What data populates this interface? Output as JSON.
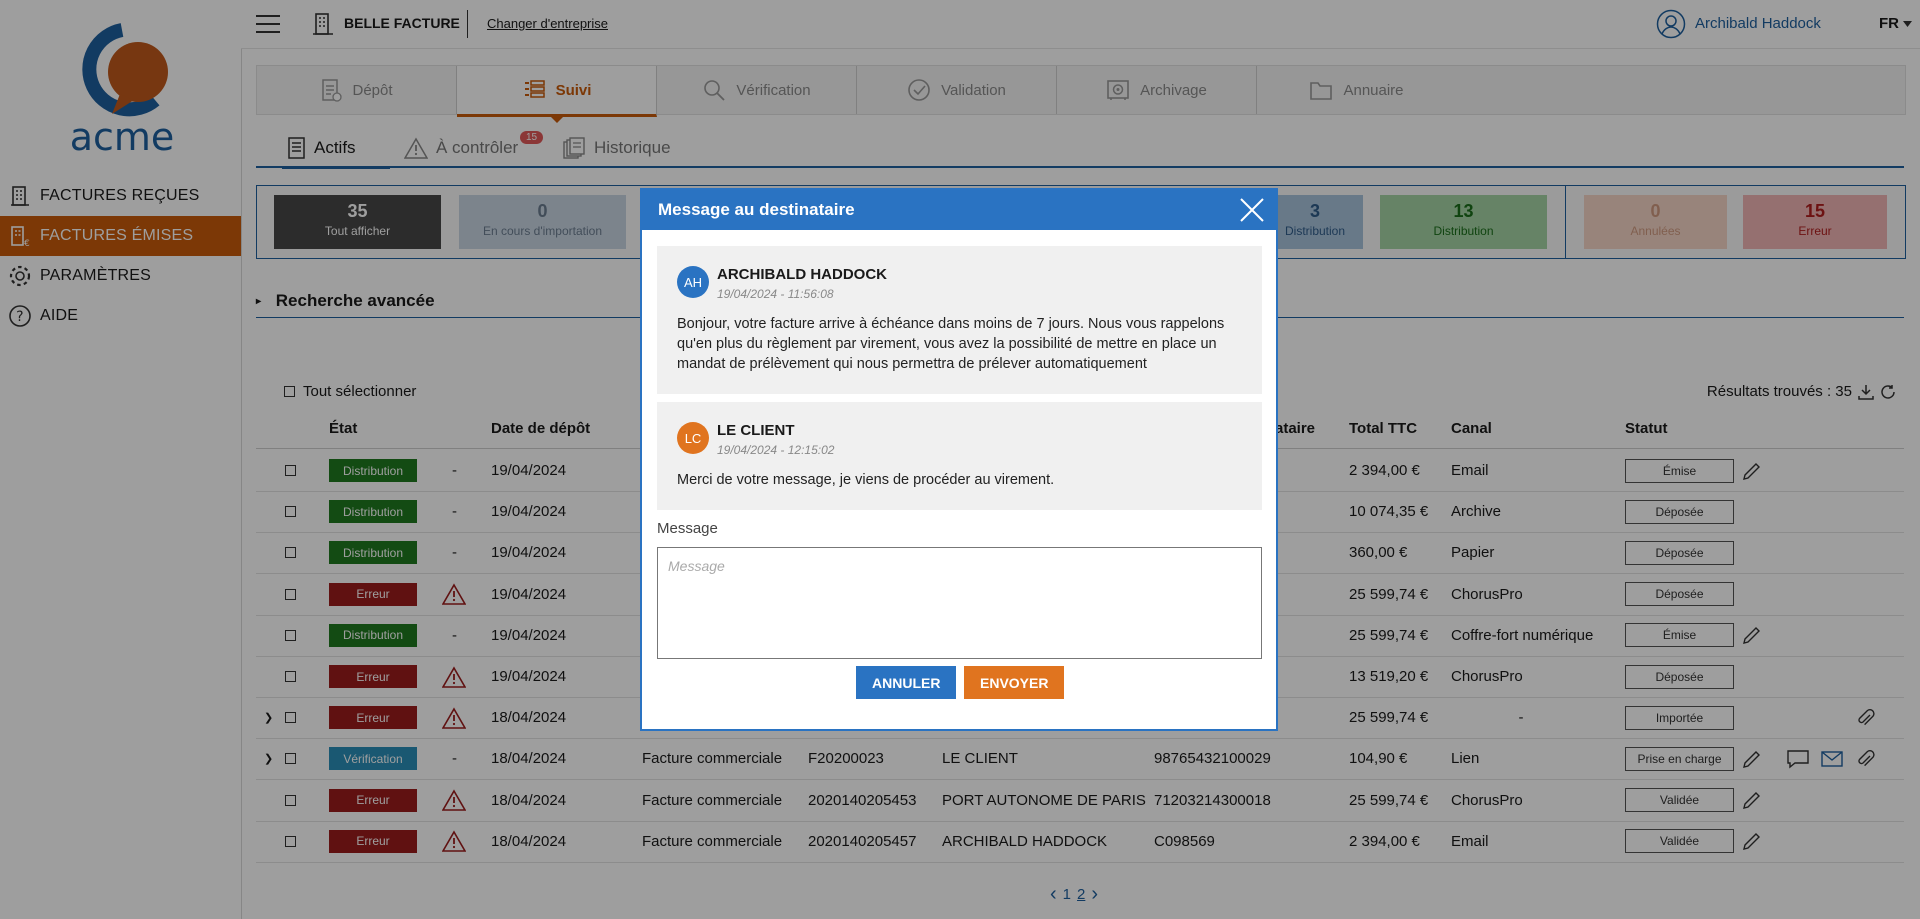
{
  "brand": {
    "logo_text": "acme",
    "company": "BELLE FACTURE",
    "change_company": "Changer d'entreprise"
  },
  "user": {
    "name": "Archibald Haddock",
    "lang": "FR"
  },
  "sidebar": {
    "items": [
      {
        "label": "FACTURES REÇUES",
        "icon": "building-icon"
      },
      {
        "label": "FACTURES ÉMISES",
        "icon": "building-euro-icon",
        "active": true
      },
      {
        "label": "PARAMÈTRES",
        "icon": "gear-icon"
      },
      {
        "label": "AIDE",
        "icon": "help-icon"
      }
    ]
  },
  "main_tabs": [
    {
      "label": "Dépôt",
      "icon": "document-icon"
    },
    {
      "label": "Suivi",
      "icon": "list-icon",
      "active": true
    },
    {
      "label": "Vérification",
      "icon": "search-icon"
    },
    {
      "label": "Validation",
      "icon": "check-circle-icon"
    },
    {
      "label": "Archivage",
      "icon": "safe-icon"
    },
    {
      "label": "Annuaire",
      "icon": "folder-icon"
    }
  ],
  "sub_tabs": [
    {
      "label": "Actifs",
      "active": true
    },
    {
      "label": "À contrôler",
      "badge": "15"
    },
    {
      "label": "Historique"
    }
  ],
  "counters": [
    {
      "value": "35",
      "label": "Tout afficher",
      "bg": "#474747",
      "fg": "#ffffff"
    },
    {
      "value": "0",
      "label": "En cours d'importation",
      "bg": "#c9d6e3",
      "fg": "#6b7d90"
    },
    {
      "value": "3",
      "label": "Distribution",
      "bg": "#a9c3dc",
      "fg": "#2f5c8a"
    },
    {
      "value": "13",
      "label": "Distribution",
      "bg": "#a5d4a5",
      "fg": "#1b6e1b"
    },
    {
      "value": "0",
      "label": "Annulées",
      "bg": "#f5d6c7",
      "fg": "#d09a80"
    },
    {
      "value": "15",
      "label": "Erreur",
      "bg": "#f0b5b5",
      "fg": "#b01e1e"
    }
  ],
  "advanced_search": "Recherche avancée",
  "select_all": "Tout sélectionner",
  "results": "Résultats trouvés : 35",
  "headers": {
    "etat": "État",
    "date": "Date de dépôt",
    "destinataire": "ataire",
    "ttc": "Total TTC",
    "canal": "Canal",
    "statut": "Statut"
  },
  "colors": {
    "distribution": "#1f7a1f",
    "erreur": "#9b1c1c",
    "verification": "#2a8fb8",
    "accent": "#c85b0a",
    "blue": "#1e5f9e"
  },
  "rows": [
    {
      "expand": "",
      "etat": "Distribution",
      "etat_kind": "distribution",
      "warn": false,
      "date": "19/04/2024",
      "type": "",
      "num": "",
      "client": "",
      "siret": "",
      "ttc": "2 394,00 €",
      "canal": "Email",
      "statut": "Émise",
      "actions": [
        "edit"
      ]
    },
    {
      "expand": "",
      "etat": "Distribution",
      "etat_kind": "distribution",
      "warn": false,
      "date": "19/04/2024",
      "type": "",
      "num": "",
      "client": "",
      "siret": "",
      "ttc": "10 074,35 €",
      "canal": "Archive",
      "statut": "Déposée",
      "actions": []
    },
    {
      "expand": "",
      "etat": "Distribution",
      "etat_kind": "distribution",
      "warn": false,
      "date": "19/04/2024",
      "type": "",
      "num": "",
      "client": "",
      "siret": "",
      "ttc": "360,00 €",
      "canal": "Papier",
      "statut": "Déposée",
      "actions": []
    },
    {
      "expand": "",
      "etat": "Erreur",
      "etat_kind": "erreur",
      "warn": true,
      "date": "19/04/2024",
      "type": "",
      "num": "",
      "client": "",
      "siret": "",
      "ttc": "25 599,74 €",
      "canal": "ChorusPro",
      "statut": "Déposée",
      "actions": []
    },
    {
      "expand": "",
      "etat": "Distribution",
      "etat_kind": "distribution",
      "warn": false,
      "date": "19/04/2024",
      "type": "",
      "num": "",
      "client": "",
      "siret": "",
      "ttc": "25 599,74 €",
      "canal": "Coffre-fort numérique",
      "statut": "Émise",
      "actions": [
        "edit"
      ]
    },
    {
      "expand": "",
      "etat": "Erreur",
      "etat_kind": "erreur",
      "warn": true,
      "date": "19/04/2024",
      "type": "",
      "num": "",
      "client": "",
      "siret": "",
      "ttc": "13 519,20 €",
      "canal": "ChorusPro",
      "statut": "Déposée",
      "actions": []
    },
    {
      "expand": "❯",
      "etat": "Erreur",
      "etat_kind": "erreur",
      "warn": true,
      "date": "18/04/2024",
      "type": "",
      "num": "",
      "client": "",
      "siret": "",
      "ttc": "25 599,74 €",
      "canal": "-",
      "statut": "Importée",
      "actions": [
        "attach"
      ]
    },
    {
      "expand": "❯",
      "etat": "Vérification",
      "etat_kind": "verification",
      "warn": false,
      "date": "18/04/2024",
      "type": "Facture commerciale",
      "num": "F20200023",
      "client": "LE CLIENT",
      "siret": "98765432100029",
      "ttc": "104,90 €",
      "canal": "Lien",
      "statut": "Prise en charge",
      "actions": [
        "edit",
        "comment",
        "mail",
        "attach"
      ]
    },
    {
      "expand": "",
      "etat": "Erreur",
      "etat_kind": "erreur",
      "warn": true,
      "date": "18/04/2024",
      "type": "Facture commerciale",
      "num": "2020140205453",
      "client": "PORT AUTONOME DE PARIS",
      "siret": "71203214300018",
      "ttc": "25 599,74 €",
      "canal": "ChorusPro",
      "statut": "Validée",
      "actions": [
        "edit"
      ]
    },
    {
      "expand": "",
      "etat": "Erreur",
      "etat_kind": "erreur",
      "warn": true,
      "date": "18/04/2024",
      "type": "Facture commerciale",
      "num": "2020140205457",
      "client": "ARCHIBALD HADDOCK",
      "siret": "C098569",
      "ttc": "2 394,00 €",
      "canal": "Email",
      "statut": "Validée",
      "actions": [
        "edit"
      ]
    }
  ],
  "pager": {
    "prev": "‹",
    "pages": [
      "1",
      "2"
    ],
    "next": "›"
  },
  "modal": {
    "title": "Message au destinataire",
    "messages": [
      {
        "initials": "AH",
        "author": "ARCHIBALD HADDOCK",
        "date": "19/04/2024 - 11:56:08",
        "color": "#2a73c2",
        "text": "Bonjour, votre facture arrive à échéance dans moins de 7 jours. Nous vous rappelons qu'en plus du règlement par virement, vous avez la possibilité de mettre en place un mandat de prélèvement qui nous permettra de prélever automatiquement"
      },
      {
        "initials": "LC",
        "author": "LE CLIENT",
        "date": "19/04/2024 - 12:15:02",
        "color": "#e0741f",
        "text": "Merci de votre message, je viens de procéder au virement."
      }
    ],
    "message_label": "Message",
    "message_placeholder": "Message",
    "message_value": "",
    "cancel": "ANNULER",
    "send": "ENVOYER"
  }
}
